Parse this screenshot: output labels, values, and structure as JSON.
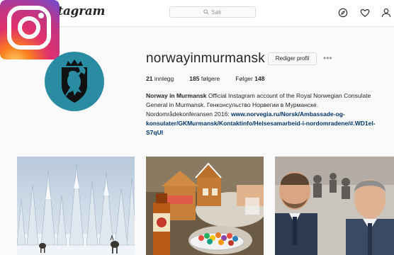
{
  "header": {
    "wordmark": "stagram",
    "search_placeholder": "Søk"
  },
  "profile": {
    "username": "norwayinmurmansk",
    "edit_button": "Rediger profil",
    "more_label": "•••",
    "stats": {
      "posts_count": "21",
      "posts_label": "innlegg",
      "followers_count": "185",
      "followers_label": "følgere",
      "following_label": "Følger",
      "following_count": "148"
    },
    "bio": {
      "name": "Norway in Murmansk",
      "text1": "Official Instagram account of the Royal Norwegian Consulate General in Murmansk. Генконсульство Норвегии в Мурманске. Nordområdekonferansen 2016: ",
      "link": "www.norvegia.ru/Norsk/Ambassade-og-konsulater/GKMurmansk/Kontaktinfo/Helsesamarbeid-i-nordomradene/#.WD1el-S7qUl"
    }
  },
  "icons": {
    "search": "search-icon",
    "explore": "compass-icon",
    "activity": "heart-icon",
    "profile": "person-icon",
    "more": "ellipsis-icon"
  },
  "posts": [
    {
      "subject": "snowy-forest"
    },
    {
      "subject": "gingerbread-house"
    },
    {
      "subject": "selfie"
    }
  ]
}
